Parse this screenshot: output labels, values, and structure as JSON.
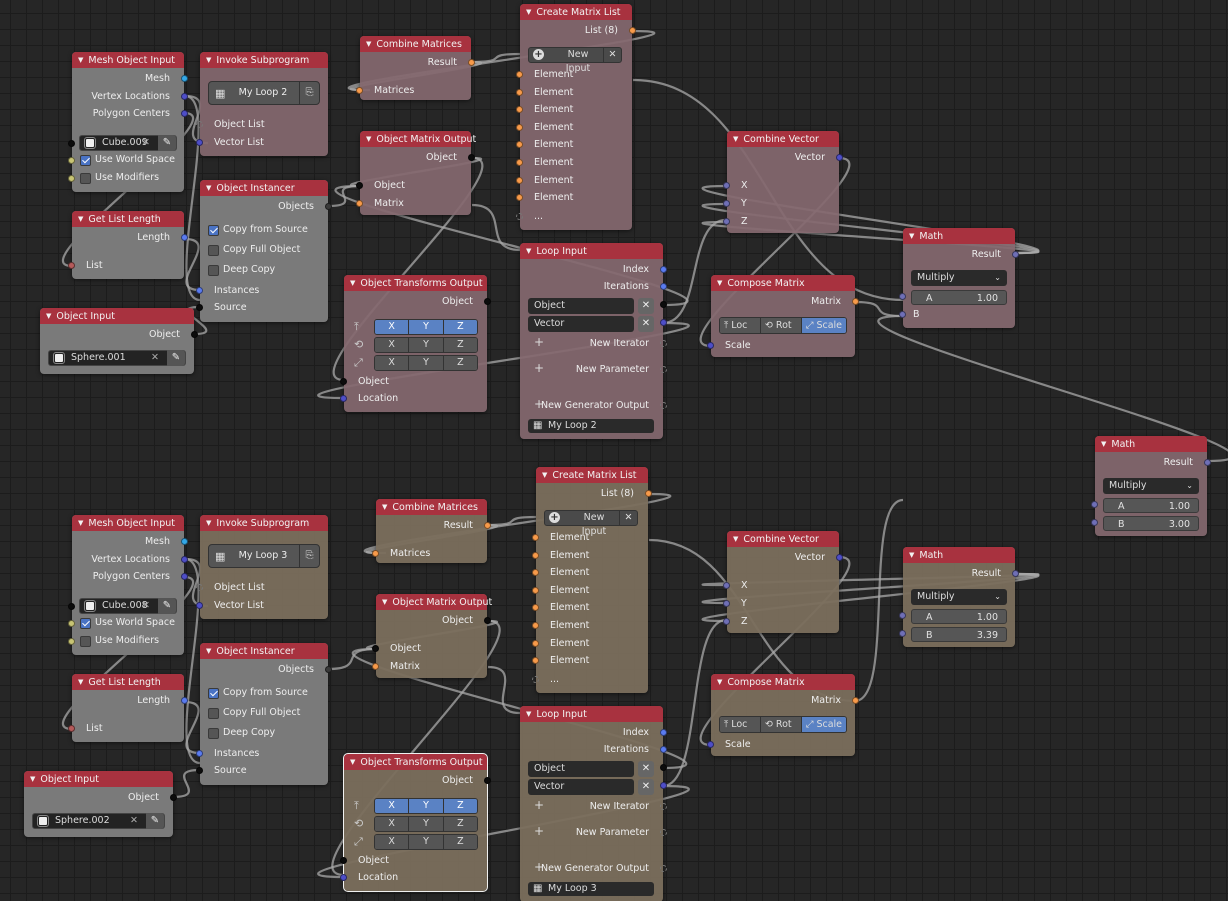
{
  "app": "Animation Nodes Editor",
  "groups": [
    {
      "id": "loop2",
      "theme": "pink",
      "mesh_object_input": {
        "title": "Mesh Object Input",
        "outputs": [
          "Mesh",
          "Vertex Locations",
          "Polygon Centers"
        ],
        "object": "Cube.009",
        "use_world_space": {
          "label": "Use World Space",
          "checked": true
        },
        "use_modifiers": {
          "label": "Use Modifiers",
          "checked": false
        }
      },
      "invoke_subprogram": {
        "title": "Invoke Subprogram",
        "program": "My Loop 2",
        "inputs": [
          "Object List",
          "Vector List"
        ]
      },
      "get_list_length": {
        "title": "Get List Length",
        "output": "Length",
        "input": "List"
      },
      "object_instancer": {
        "title": "Object Instancer",
        "output": "Objects",
        "options": [
          {
            "label": "Copy from Source",
            "checked": true
          },
          {
            "label": "Copy Full Object",
            "checked": false
          },
          {
            "label": "Deep Copy",
            "checked": false
          }
        ],
        "inputs": [
          "Instances",
          "Source"
        ]
      },
      "object_input": {
        "title": "Object Input",
        "output": "Object",
        "object": "Sphere.001"
      },
      "combine_matrices": {
        "title": "Combine Matrices",
        "output": "Result",
        "input": "Matrices"
      },
      "object_matrix_output": {
        "title": "Object Matrix Output",
        "output": "Object",
        "inputs": [
          "Object",
          "Matrix"
        ]
      },
      "object_transforms_output": {
        "title": "Object Transforms Output",
        "output": "Object",
        "axes": [
          "X",
          "Y",
          "Z"
        ],
        "inputs": [
          "Object",
          "Location"
        ]
      },
      "create_matrix_list": {
        "title": "Create Matrix List",
        "output": "List (8)",
        "new_input": "New Input",
        "elements": [
          "Element",
          "Element",
          "Element",
          "Element",
          "Element",
          "Element",
          "Element",
          "Element"
        ],
        "more": "..."
      },
      "loop_input": {
        "title": "Loop Input",
        "outputs": [
          "Index",
          "Iterations"
        ],
        "iterators": [
          "Object",
          "Vector"
        ],
        "new_iterator": "New Iterator",
        "new_parameter": "New Parameter",
        "new_generator": "New Generator Output",
        "loop_name": "My Loop 2"
      },
      "combine_vector": {
        "title": "Combine Vector",
        "output": "Vector",
        "inputs": [
          "X",
          "Y",
          "Z"
        ]
      },
      "compose_matrix": {
        "title": "Compose Matrix",
        "output": "Matrix",
        "modes": [
          {
            "label": "Loc",
            "active": false
          },
          {
            "label": "Rot",
            "active": false
          },
          {
            "label": "Scale",
            "active": true
          }
        ],
        "input": "Scale"
      },
      "math": {
        "title": "Math",
        "output": "Result",
        "operation": "Multiply",
        "a_label": "A",
        "a": "1.00",
        "b_label": "B"
      }
    },
    {
      "id": "loop3",
      "theme": "tan",
      "mesh_object_input": {
        "title": "Mesh Object Input",
        "outputs": [
          "Mesh",
          "Vertex Locations",
          "Polygon Centers"
        ],
        "object": "Cube.008",
        "use_world_space": {
          "label": "Use World Space",
          "checked": true
        },
        "use_modifiers": {
          "label": "Use Modifiers",
          "checked": false
        }
      },
      "invoke_subprogram": {
        "title": "Invoke Subprogram",
        "program": "My Loop 3",
        "inputs": [
          "Object List",
          "Vector List"
        ]
      },
      "get_list_length": {
        "title": "Get List Length",
        "output": "Length",
        "input": "List"
      },
      "object_instancer": {
        "title": "Object Instancer",
        "output": "Objects",
        "options": [
          {
            "label": "Copy from Source",
            "checked": true
          },
          {
            "label": "Copy Full Object",
            "checked": false
          },
          {
            "label": "Deep Copy",
            "checked": false
          }
        ],
        "inputs": [
          "Instances",
          "Source"
        ]
      },
      "object_input": {
        "title": "Object Input",
        "output": "Object",
        "object": "Sphere.002"
      },
      "combine_matrices": {
        "title": "Combine Matrices",
        "output": "Result",
        "input": "Matrices"
      },
      "object_matrix_output": {
        "title": "Object Matrix Output",
        "output": "Object",
        "inputs": [
          "Object",
          "Matrix"
        ]
      },
      "object_transforms_output": {
        "title": "Object Transforms Output",
        "output": "Object",
        "axes": [
          "X",
          "Y",
          "Z"
        ],
        "inputs": [
          "Object",
          "Location"
        ]
      },
      "create_matrix_list": {
        "title": "Create Matrix List",
        "output": "List (8)",
        "new_input": "New Input",
        "elements": [
          "Element",
          "Element",
          "Element",
          "Element",
          "Element",
          "Element",
          "Element",
          "Element"
        ],
        "more": "..."
      },
      "loop_input": {
        "title": "Loop Input",
        "outputs": [
          "Index",
          "Iterations"
        ],
        "iterators": [
          "Object",
          "Vector"
        ],
        "new_iterator": "New Iterator",
        "new_parameter": "New Parameter",
        "new_generator": "New Generator Output",
        "loop_name": "My Loop 3"
      },
      "combine_vector": {
        "title": "Combine Vector",
        "output": "Vector",
        "inputs": [
          "X",
          "Y",
          "Z"
        ]
      },
      "compose_matrix": {
        "title": "Compose Matrix",
        "output": "Matrix",
        "modes": [
          {
            "label": "Loc",
            "active": false
          },
          {
            "label": "Rot",
            "active": false
          },
          {
            "label": "Scale",
            "active": true
          }
        ],
        "input": "Scale"
      },
      "math": {
        "title": "Math",
        "output": "Result",
        "operation": "Multiply",
        "a_label": "A",
        "a": "1.00",
        "b_label": "B",
        "b": "3.39"
      }
    }
  ],
  "standalone_math": {
    "title": "Math",
    "output": "Result",
    "operation": "Multiply",
    "a_label": "A",
    "a": "1.00",
    "b_label": "B",
    "b": "3.00"
  },
  "icons": {
    "collapse": "triangle-down",
    "checkbox": "check",
    "eyedropper": "eyedropper",
    "clear": "x",
    "add": "plus-circle",
    "loc": "arrow-up",
    "rot": "rotate",
    "scale": "expand",
    "group": "node-tree"
  }
}
